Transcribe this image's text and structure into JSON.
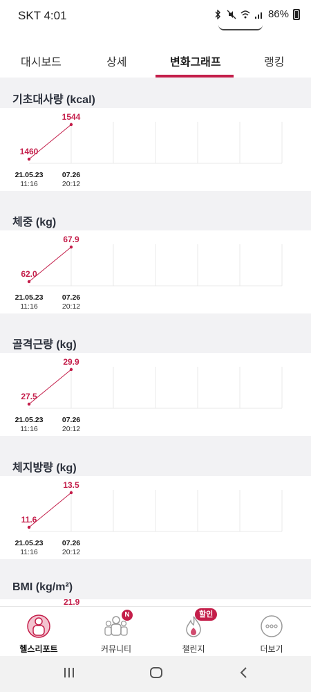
{
  "status_bar": {
    "time": "SKT 4:01",
    "battery": "86%"
  },
  "tabs": [
    {
      "label": "대시보드",
      "active": false
    },
    {
      "label": "상세",
      "active": false
    },
    {
      "label": "변화그래프",
      "active": true
    },
    {
      "label": "랭킹",
      "active": false
    }
  ],
  "accent_color": "#c41e4a",
  "charts": [
    {
      "title": "기초대사량 (kcal)",
      "chart_data": {
        "type": "line",
        "x": [
          "21.05.23 11:16",
          "07.26 20:12"
        ],
        "values": [
          1460,
          1544
        ],
        "value_labels": [
          "1460",
          "1544"
        ]
      },
      "x_labels": [
        {
          "date": "21.05.23",
          "time": "11:16"
        },
        {
          "date": "07.26",
          "time": "20:12"
        }
      ]
    },
    {
      "title": "체중 (kg)",
      "chart_data": {
        "type": "line",
        "x": [
          "21.05.23 11:16",
          "07.26 20:12"
        ],
        "values": [
          62.0,
          67.9
        ],
        "value_labels": [
          "62.0",
          "67.9"
        ]
      },
      "x_labels": [
        {
          "date": "21.05.23",
          "time": "11:16"
        },
        {
          "date": "07.26",
          "time": "20:12"
        }
      ]
    },
    {
      "title": "골격근량 (kg)",
      "chart_data": {
        "type": "line",
        "x": [
          "21.05.23 11:16",
          "07.26 20:12"
        ],
        "values": [
          27.5,
          29.9
        ],
        "value_labels": [
          "27.5",
          "29.9"
        ]
      },
      "x_labels": [
        {
          "date": "21.05.23",
          "time": "11:16"
        },
        {
          "date": "07.26",
          "time": "20:12"
        }
      ]
    },
    {
      "title": "체지방량 (kg)",
      "chart_data": {
        "type": "line",
        "x": [
          "21.05.23 11:16",
          "07.26 20:12"
        ],
        "values": [
          11.6,
          13.5
        ],
        "value_labels": [
          "11.6",
          "13.5"
        ]
      },
      "x_labels": [
        {
          "date": "21.05.23",
          "time": "11:16"
        },
        {
          "date": "07.26",
          "time": "20:12"
        }
      ]
    },
    {
      "title": "BMI (kg/m²)",
      "chart_data": {
        "type": "line",
        "x": [],
        "values": [],
        "value_labels": [
          "21.9"
        ]
      },
      "x_labels": []
    }
  ],
  "bottom_nav": [
    {
      "label": "헬스리포트",
      "icon": "health-report-icon",
      "active": true
    },
    {
      "label": "커뮤니티",
      "icon": "community-icon",
      "badge": "N",
      "active": false
    },
    {
      "label": "챌린지",
      "icon": "challenge-flame-icon",
      "badge": "할인",
      "active": false
    },
    {
      "label": "더보기",
      "icon": "more-icon",
      "active": false
    }
  ]
}
